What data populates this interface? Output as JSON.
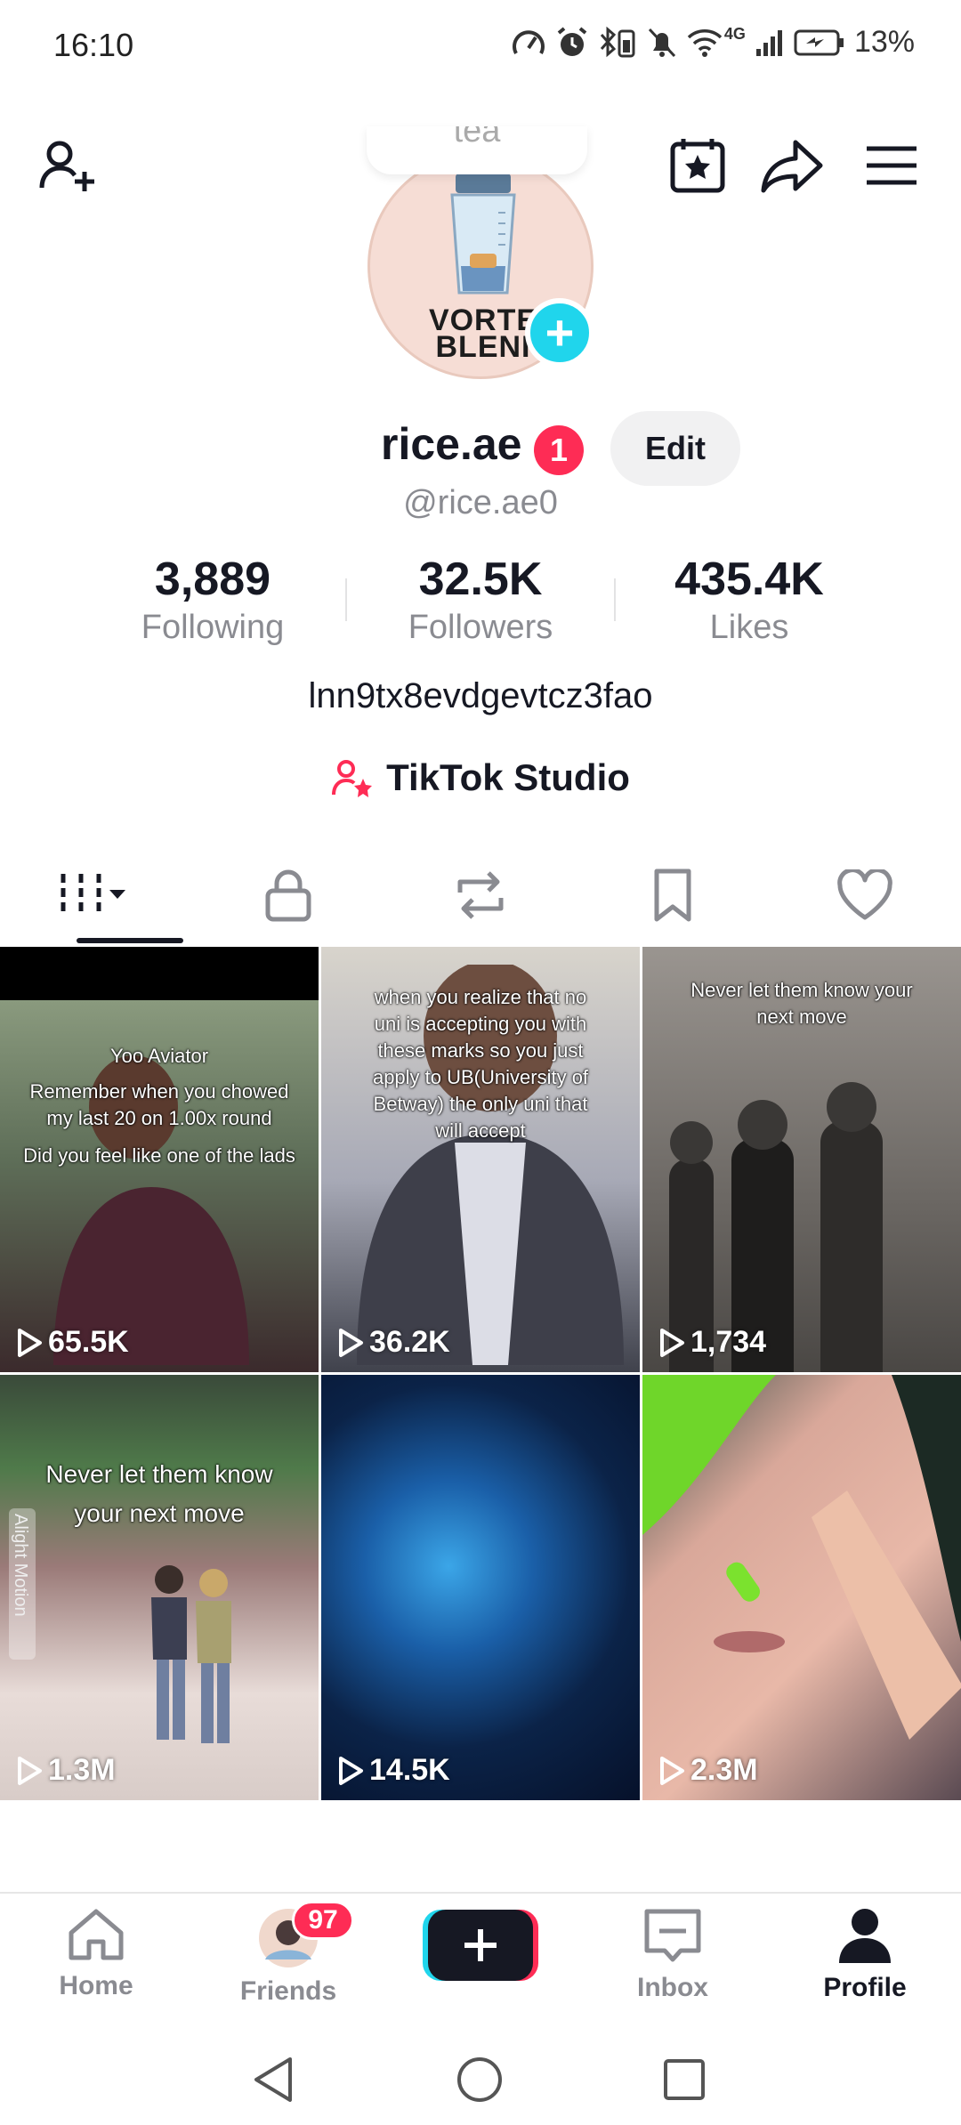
{
  "status_bar": {
    "time": "16:10",
    "network": "4G",
    "battery": "13%"
  },
  "header": {
    "note_text": "tea",
    "avatar_text_line1": "VORTE",
    "avatar_text_line2": "BLENI"
  },
  "profile": {
    "username": "rice.ae",
    "notification_count": "1",
    "edit_label": "Edit",
    "handle": "@rice.ae0",
    "bio": "lnn9tx8evdgevtcz3fao",
    "studio_label": "TikTok Studio"
  },
  "stats": [
    {
      "value": "3,889",
      "label": "Following"
    },
    {
      "value": "32.5K",
      "label": "Followers"
    },
    {
      "value": "435.4K",
      "label": "Likes"
    }
  ],
  "videos": [
    {
      "views": "65.5K",
      "caption": [
        "Yoo Aviator",
        "",
        "Remember when you chowed",
        "my last 20 on 1.00x round",
        "",
        "Did you feel like one of the lads"
      ]
    },
    {
      "views": "36.2K",
      "caption": [
        "when you realize that no",
        "uni is accepting you with",
        "these marks so you just",
        "apply to UB(University of",
        "Betway) the only uni that",
        "will accept"
      ]
    },
    {
      "views": "1,734",
      "caption": [
        "Never let them know your",
        "next move"
      ]
    },
    {
      "views": "1.3M",
      "caption": [
        "Never let them know",
        "your next move"
      ],
      "watermark": "Alight Motion"
    },
    {
      "views": "14.5K",
      "caption": []
    },
    {
      "views": "2.3M",
      "caption": []
    }
  ],
  "bottom_nav": {
    "home": "Home",
    "friends": "Friends",
    "friends_badge": "97",
    "inbox": "Inbox",
    "profile": "Profile"
  },
  "colors": {
    "accent": "#fe2c55",
    "cyan": "#20d5ec",
    "text": "#161823",
    "muted": "#8a8b91"
  }
}
